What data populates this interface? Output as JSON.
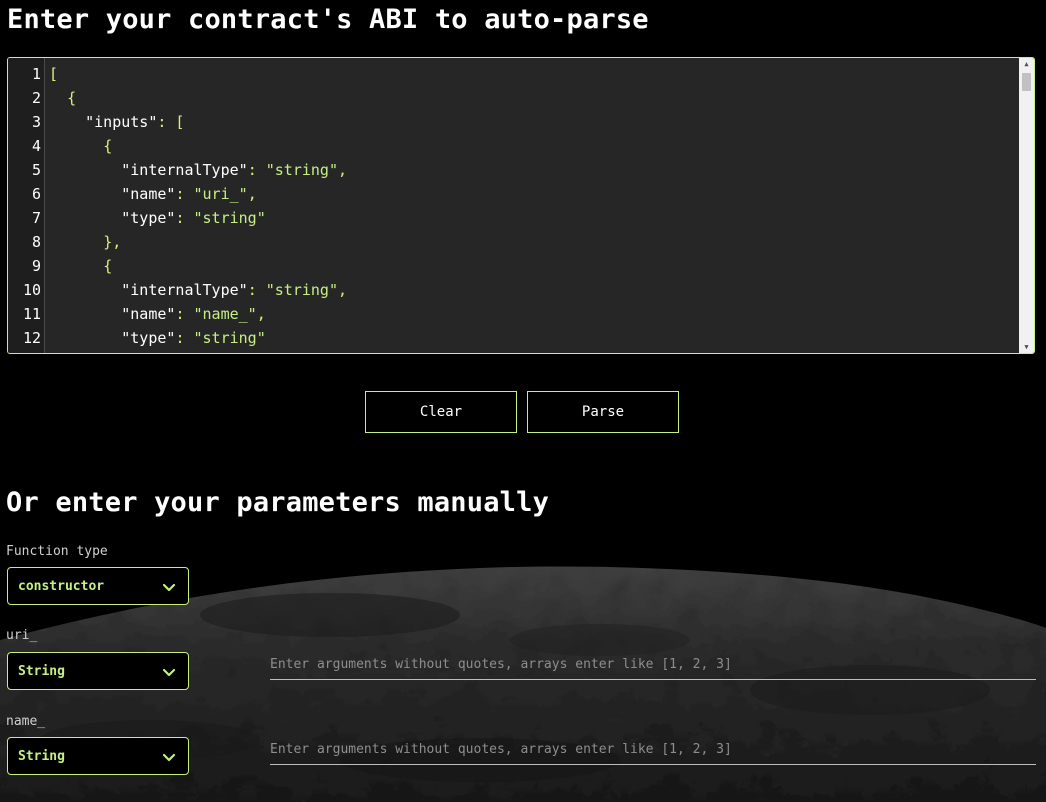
{
  "abi_section": {
    "title": "Enter your contract's ABI to auto-parse",
    "line_numbers": [
      "1",
      "2",
      "3",
      "4",
      "5",
      "6",
      "7",
      "8",
      "9",
      "10",
      "11",
      "12"
    ],
    "code": {
      "l1": "[",
      "l2": "{",
      "l3_key": "\"inputs\"",
      "l3_rest": ": [",
      "l4": "{",
      "l5_key": "\"internalType\"",
      "l5_colon": ": ",
      "l5_val": "\"string\"",
      "l5_end": ",",
      "l6_key": "\"name\"",
      "l6_colon": ": ",
      "l6_val": "\"uri_\"",
      "l6_end": ",",
      "l7_key": "\"type\"",
      "l7_colon": ": ",
      "l7_val": "\"string\"",
      "l8": "},",
      "l9": "{",
      "l10_key": "\"internalType\"",
      "l10_colon": ": ",
      "l10_val": "\"string\"",
      "l10_end": ",",
      "l11_key": "\"name\"",
      "l11_colon": ": ",
      "l11_val": "\"name_\"",
      "l11_end": ",",
      "l12_key": "\"type\"",
      "l12_colon": ": ",
      "l12_val": "\"string\""
    },
    "clear_label": "Clear",
    "parse_label": "Parse"
  },
  "manual_section": {
    "title": "Or enter your parameters manually",
    "function_type_label": "Function type",
    "function_type_value": "constructor",
    "params": [
      {
        "name": "uri_",
        "type": "String",
        "placeholder": "Enter arguments without quotes, arrays enter like [1, 2, 3]"
      },
      {
        "name": "name_",
        "type": "String",
        "placeholder": "Enter arguments without quotes, arrays enter like [1, 2, 3]"
      }
    ]
  },
  "icons": {
    "select_chevron": "chevron-down-icon",
    "scroll_up": "scroll-up-arrow-icon",
    "scroll_down": "scroll-down-arrow-icon"
  },
  "colors": {
    "accent": "#c4f07e",
    "background": "#000000",
    "editor_bg": "#262626"
  }
}
